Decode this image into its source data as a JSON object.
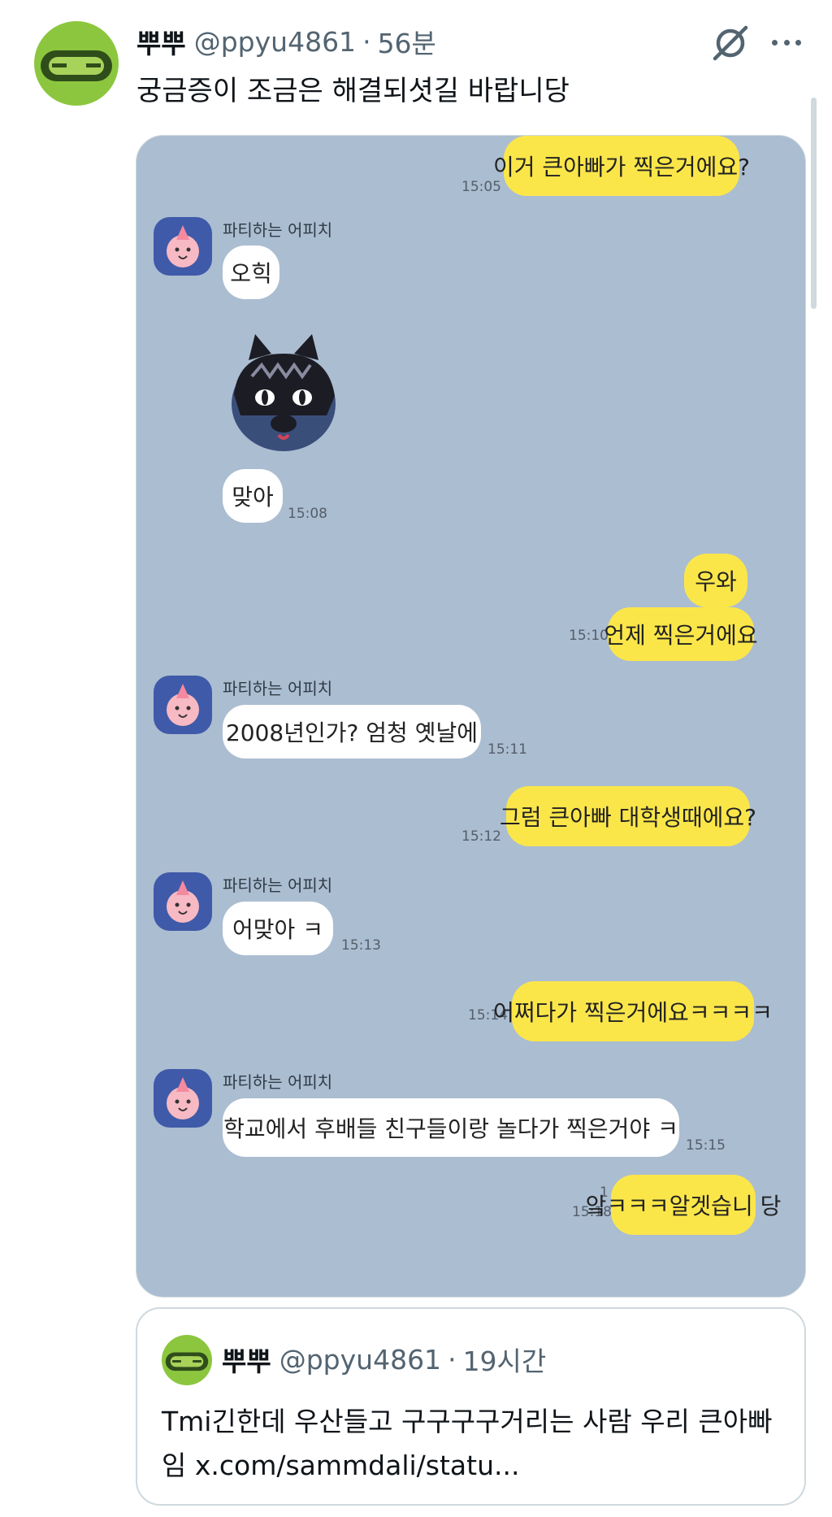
{
  "tweet": {
    "display_name": "뿌뿌",
    "handle": "@ppyu4861",
    "separator": "·",
    "time": "56분",
    "text": "궁금증이 조금은 해결되셧길 바랍니당"
  },
  "chat": {
    "messages": [
      {
        "side": "me",
        "text": "이거 큰아빠가 찍은거에요?",
        "time": "15:05"
      },
      {
        "side": "them",
        "sender": "파티하는 어피치",
        "text": "오힉"
      },
      {
        "side": "them",
        "emoticon": "black-cat-emoticon"
      },
      {
        "side": "them",
        "text": "맞아",
        "time": "15:08"
      },
      {
        "side": "me",
        "text": "우와"
      },
      {
        "side": "me",
        "text": "언제 찍은거에요",
        "time": "15:10"
      },
      {
        "side": "them",
        "sender": "파티하는 어피치",
        "text": "2008년인가? 엄청 옛날에",
        "time": "15:11"
      },
      {
        "side": "me",
        "text": "그럼 큰아빠 대학생때에요?",
        "time": "15:12"
      },
      {
        "side": "them",
        "sender": "파티하는 어피치",
        "text": "어맞아 ㅋ",
        "time": "15:13"
      },
      {
        "side": "me",
        "text": "어쩌다가 찍은거에요ㅋㅋㅋㅋ",
        "time": "15:14"
      },
      {
        "side": "them",
        "sender": "파티하는 어피치",
        "text": "학교에서 후배들 친구들이랑 놀다가 찍은거야 ㅋ",
        "time": "15:15"
      },
      {
        "side": "me",
        "text": "앜ㅋㅋㅋ알겟습니 당",
        "time": "15:18",
        "read_count": "1"
      }
    ]
  },
  "quote": {
    "display_name": "뿌뿌",
    "handle": "@ppyu4861",
    "separator": "·",
    "time": "19시간",
    "text": "Tmi긴한데 우산들고 구구구구거리는 사람 우리 큰아빠임 x.com/sammdali/statu..."
  },
  "colors": {
    "avatar_green": "#8cc63f",
    "chat_background": "#abbdd1",
    "my_bubble": "#fbe64a",
    "their_bubble": "#ffffff",
    "secondary_text": "#536471"
  },
  "icons": [
    "grok-icon",
    "more-icon"
  ]
}
